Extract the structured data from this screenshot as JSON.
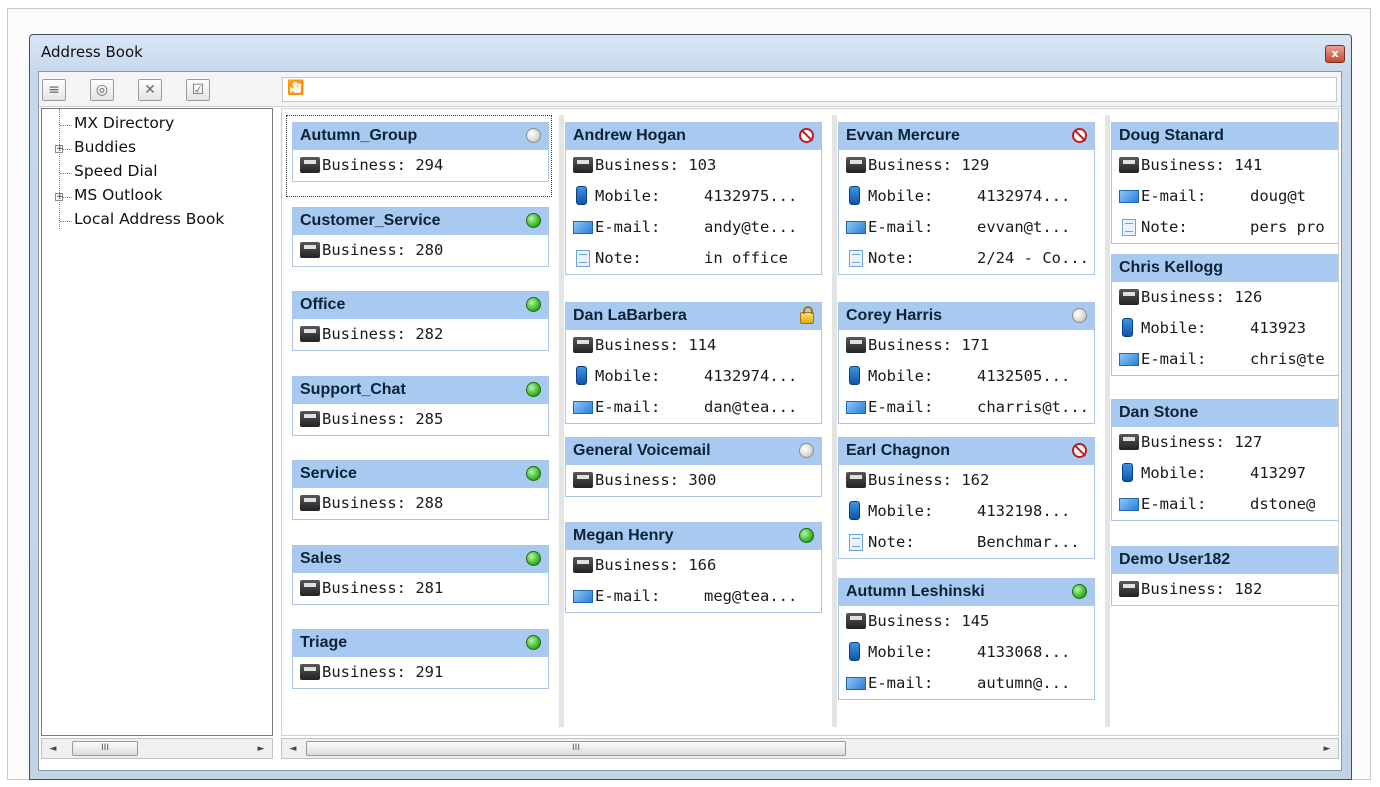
{
  "window": {
    "title": "Address Book",
    "close_label": "x"
  },
  "toolbar": {
    "buttons": [
      {
        "name": "contact-card-icon",
        "glyph": "≡"
      },
      {
        "name": "globe-icon",
        "glyph": "◎"
      },
      {
        "name": "delete-icon",
        "glyph": "✕"
      },
      {
        "name": "checklist-icon",
        "glyph": "☑"
      }
    ],
    "search_icon": "binoculars-icon",
    "search_value": ""
  },
  "tree": {
    "items": [
      {
        "label": "MX Directory",
        "expandable": false
      },
      {
        "label": "Buddies",
        "expandable": true
      },
      {
        "label": "Speed Dial",
        "expandable": false
      },
      {
        "label": "MS Outlook",
        "expandable": true
      },
      {
        "label": "Local Address Book",
        "expandable": false
      }
    ]
  },
  "columns": [
    [
      {
        "name": "Autumn_Group",
        "status": "grey",
        "rows": [
          {
            "type": "business",
            "label": "Business: 294"
          }
        ]
      },
      {
        "name": "Customer_Service",
        "status": "green",
        "rows": [
          {
            "type": "business",
            "label": "Business: 280"
          }
        ]
      },
      {
        "name": "Office",
        "status": "green",
        "rows": [
          {
            "type": "business",
            "label": "Business: 282"
          }
        ]
      },
      {
        "name": "Support_Chat",
        "status": "green",
        "rows": [
          {
            "type": "business",
            "label": "Business: 285"
          }
        ]
      },
      {
        "name": "Service",
        "status": "green",
        "rows": [
          {
            "type": "business",
            "label": "Business: 288"
          }
        ]
      },
      {
        "name": "Sales",
        "status": "green",
        "rows": [
          {
            "type": "business",
            "label": "Business: 281"
          }
        ]
      },
      {
        "name": "Triage",
        "status": "green",
        "rows": [
          {
            "type": "business",
            "label": "Business: 291"
          }
        ]
      }
    ],
    [
      {
        "name": "Andrew Hogan",
        "status": "dnd",
        "rows": [
          {
            "type": "business",
            "label": "Business: 103"
          },
          {
            "type": "mobile",
            "label": "Mobile:",
            "value": "4132975..."
          },
          {
            "type": "email",
            "label": "E-mail:",
            "value": "andy@te..."
          },
          {
            "type": "note",
            "label": "Note:",
            "value": "in office"
          }
        ]
      },
      {
        "name": "Dan LaBarbera",
        "status": "lock",
        "rows": [
          {
            "type": "business",
            "label": "Business: 114"
          },
          {
            "type": "mobile",
            "label": "Mobile:",
            "value": "4132974..."
          },
          {
            "type": "email",
            "label": "E-mail:",
            "value": "dan@tea..."
          }
        ]
      },
      {
        "name": "General Voicemail",
        "status": "grey",
        "rows": [
          {
            "type": "business",
            "label": "Business: 300"
          }
        ]
      },
      {
        "name": "Megan Henry",
        "status": "green",
        "rows": [
          {
            "type": "business",
            "label": "Business: 166"
          },
          {
            "type": "email",
            "label": "E-mail:",
            "value": "meg@tea..."
          }
        ]
      }
    ],
    [
      {
        "name": "Evvan Mercure",
        "status": "dnd",
        "rows": [
          {
            "type": "business",
            "label": "Business: 129"
          },
          {
            "type": "mobile",
            "label": "Mobile:",
            "value": "4132974..."
          },
          {
            "type": "email",
            "label": "E-mail:",
            "value": "evvan@t..."
          },
          {
            "type": "note",
            "label": "Note:",
            "value": "2/24 - Co..."
          }
        ]
      },
      {
        "name": "Corey Harris",
        "status": "grey",
        "rows": [
          {
            "type": "business",
            "label": "Business: 171"
          },
          {
            "type": "mobile",
            "label": "Mobile:",
            "value": "4132505..."
          },
          {
            "type": "email",
            "label": "E-mail:",
            "value": "charris@t..."
          }
        ]
      },
      {
        "name": "Earl Chagnon",
        "status": "dnd",
        "rows": [
          {
            "type": "business",
            "label": "Business: 162"
          },
          {
            "type": "mobile",
            "label": "Mobile:",
            "value": "4132198..."
          },
          {
            "type": "note",
            "label": "Note:",
            "value": "Benchmar..."
          }
        ]
      },
      {
        "name": "Autumn Leshinski",
        "status": "green",
        "rows": [
          {
            "type": "business",
            "label": "Business: 145"
          },
          {
            "type": "mobile",
            "label": "Mobile:",
            "value": "4133068..."
          },
          {
            "type": "email",
            "label": "E-mail:",
            "value": "autumn@..."
          }
        ]
      }
    ],
    [
      {
        "name": "Doug Stanard",
        "status": "none",
        "rows": [
          {
            "type": "business",
            "label": "Business: 141"
          },
          {
            "type": "email",
            "label": "E-mail:",
            "value": "doug@t"
          },
          {
            "type": "note",
            "label": "Note:",
            "value": "pers pro"
          }
        ]
      },
      {
        "name": "Chris Kellogg",
        "status": "none",
        "rows": [
          {
            "type": "business",
            "label": "Business: 126"
          },
          {
            "type": "mobile",
            "label": "Mobile:",
            "value": "413923"
          },
          {
            "type": "email",
            "label": "E-mail:",
            "value": "chris@te"
          }
        ]
      },
      {
        "name": "Dan Stone",
        "status": "none",
        "rows": [
          {
            "type": "business",
            "label": "Business: 127"
          },
          {
            "type": "mobile",
            "label": "Mobile:",
            "value": "413297"
          },
          {
            "type": "email",
            "label": "E-mail:",
            "value": "dstone@"
          }
        ]
      },
      {
        "name": "Demo User182",
        "status": "none",
        "rows": [
          {
            "type": "business",
            "label": "Business: 182"
          }
        ]
      }
    ]
  ],
  "scrollbars": {
    "thumb_grip": "III",
    "left_arrow": "◄",
    "right_arrow": "►"
  }
}
